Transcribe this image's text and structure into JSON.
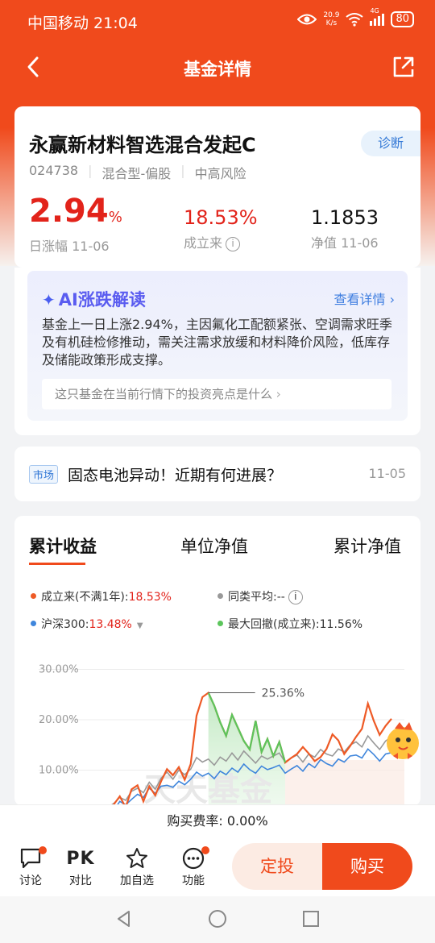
{
  "status_bar": {
    "carrier_time": "中国移动 21:04",
    "speed_value": "20.9",
    "speed_unit": "K/s",
    "signal_label": "4G",
    "battery": "80"
  },
  "header": {
    "title": "基金详情"
  },
  "fund": {
    "name": "永赢新材料智选混合发起C",
    "diagnose": "诊断",
    "code": "024738",
    "type": "混合型-偏股",
    "risk": "中高风险",
    "daily_change_value": "2.94",
    "daily_change_unit": "%",
    "daily_change_label": "日涨幅 11-06",
    "since_inception_value": "18.53%",
    "since_inception_label": "成立来",
    "nav_value": "1.1853",
    "nav_label": "净值 11-06"
  },
  "ai": {
    "title": "AI涨跌解读",
    "more": "查看详情",
    "text": "基金上一日上涨2.94%，主因氟化工配额紧张、空调需求旺季及有机硅检修推动，需关注需求放缓和材料降价风险，低库存及储能政策形成支撑。",
    "question": "这只基金在当前行情下的投资亮点是什么"
  },
  "news": {
    "tag": "市场",
    "title": "固态电池异动！近期有何进展？",
    "date": "11-05"
  },
  "chart_tabs": [
    "累计收益",
    "单位净值",
    "累计净值"
  ],
  "legend": {
    "fund_label": "成立来(不满1年):",
    "fund_value": "18.53%",
    "peer_label": "同类平均:",
    "peer_value": "--",
    "index_label": "沪深300:",
    "index_value": "13.48%",
    "drawdown_label": "最大回撤(成立来):",
    "drawdown_value": "11.56%"
  },
  "colors": {
    "fund": "#ee5a26",
    "peer": "#999999",
    "index": "#3f86dc",
    "drawdown": "#5cc55c",
    "brand": "#f04a1c"
  },
  "chart_data": {
    "type": "line",
    "ylabel_ticks": [
      "30.00%",
      "20.00%",
      "10.00%"
    ],
    "ylim": [
      0,
      32
    ],
    "peak_label": "25.36%",
    "watermark": "天天基金",
    "series": [
      {
        "name": "成立来(不满1年)",
        "values": [
          0,
          1.2,
          2.0,
          1.5,
          3.2,
          4.8,
          2.6,
          6.2,
          7.0,
          3.8,
          6.8,
          5.0,
          7.8,
          10.2,
          9.0,
          10.6,
          8.1,
          11.2,
          20.8,
          24.5,
          25.36,
          22.8,
          19.5,
          16.8,
          21.0,
          18.4,
          15.8,
          14.1,
          19.8,
          13.6,
          16.2,
          12.8,
          15.6,
          11.5,
          12.4,
          13.2,
          14.6,
          13.3,
          11.8,
          12.6,
          14.2,
          17.1,
          15.9,
          13.2,
          14.8,
          16.6,
          18.2,
          23.2,
          19.8,
          17.0,
          18.8,
          20.2
        ]
      },
      {
        "name": "沪深300",
        "values": [
          0,
          0.8,
          1.5,
          2.5,
          2.0,
          3.8,
          3.1,
          4.2,
          5.2,
          4.6,
          6.4,
          5.4,
          6.8,
          7.0,
          6.6,
          7.8,
          7.1,
          8.2,
          9.6,
          8.8,
          9.4,
          8.3,
          9.8,
          9.1,
          10.4,
          9.6,
          11.2,
          10.1,
          9.4,
          10.8,
          10.1,
          10.5,
          11.0,
          9.4,
          10.2,
          10.9,
          9.8,
          11.3,
          10.5,
          12.1,
          11.3,
          10.8,
          12.2,
          11.6,
          12.8,
          13.0,
          12.4,
          14.2,
          13.1,
          11.8,
          13.2,
          13.48
        ]
      },
      {
        "name": "同类平均",
        "values": [
          0,
          1.0,
          1.8,
          2.6,
          3.4,
          4.6,
          4.0,
          5.8,
          6.4,
          5.5,
          7.6,
          6.2,
          8.4,
          9.6,
          8.2,
          10.0,
          9.1,
          10.2,
          12.5,
          11.6,
          12.2,
          11.0,
          12.6,
          11.8,
          13.4,
          12.0,
          13.8,
          12.6,
          11.4,
          12.8,
          12.2,
          12.8,
          13.4,
          11.6,
          12.4,
          13.0,
          11.6,
          13.2,
          12.6,
          14.1,
          13.2,
          12.8,
          14.2,
          13.6,
          15.0,
          15.6,
          14.6,
          16.8,
          15.4,
          14.1,
          15.8,
          16.6
        ]
      }
    ]
  },
  "fee": "购买费率:  0.00%",
  "bottom": {
    "discuss": "讨论",
    "compare_icon": "PK",
    "compare": "对比",
    "watch": "加自选",
    "func": "功能",
    "plan": "定投",
    "buy": "购买"
  }
}
